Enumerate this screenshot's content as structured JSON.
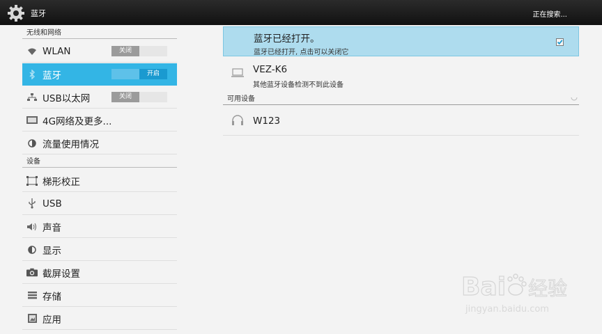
{
  "actionbar": {
    "title": "蓝牙",
    "status": "正在搜索..."
  },
  "sidebar": {
    "sections": [
      {
        "title": "无线和网络"
      },
      {
        "title": "设备"
      }
    ],
    "items": [
      {
        "label": "WLAN",
        "icon": "wifi-icon",
        "toggle": "关闭",
        "toggle_state": "off"
      },
      {
        "label": "蓝牙",
        "icon": "bluetooth-icon",
        "toggle": "开启",
        "toggle_state": "on",
        "selected": true
      },
      {
        "label": "USB以太网",
        "icon": "ethernet-icon",
        "toggle": "关闭",
        "toggle_state": "off"
      },
      {
        "label": "4G网络及更多...",
        "icon": "network-more-icon"
      },
      {
        "label": "流量使用情况",
        "icon": "data-usage-icon"
      },
      {
        "label": "梯形校正",
        "icon": "keystone-icon"
      },
      {
        "label": "USB",
        "icon": "usb-icon"
      },
      {
        "label": "声音",
        "icon": "sound-icon"
      },
      {
        "label": "显示",
        "icon": "display-icon"
      },
      {
        "label": "截屏设置",
        "icon": "camera-icon"
      },
      {
        "label": "存储",
        "icon": "storage-icon"
      },
      {
        "label": "应用",
        "icon": "apps-icon"
      }
    ]
  },
  "bluetooth": {
    "title": "蓝牙已经打开。",
    "subtitle": "蓝牙已经打开, 点击可以关闭它",
    "checked": true,
    "this_device": {
      "name": "VEZ-K6",
      "desc": "其他蓝牙设备检测不到此设备",
      "icon": "laptop-icon"
    },
    "available_header": "可用设备",
    "available": [
      {
        "name": "W123",
        "icon": "headset-icon"
      }
    ]
  },
  "watermark": {
    "brand": "Baidu经验",
    "url": "jingyan.baidu.com"
  },
  "colors": {
    "accent": "#33b5e5",
    "highlight": "#aedcee",
    "actionbar": "#1a1a1a"
  }
}
